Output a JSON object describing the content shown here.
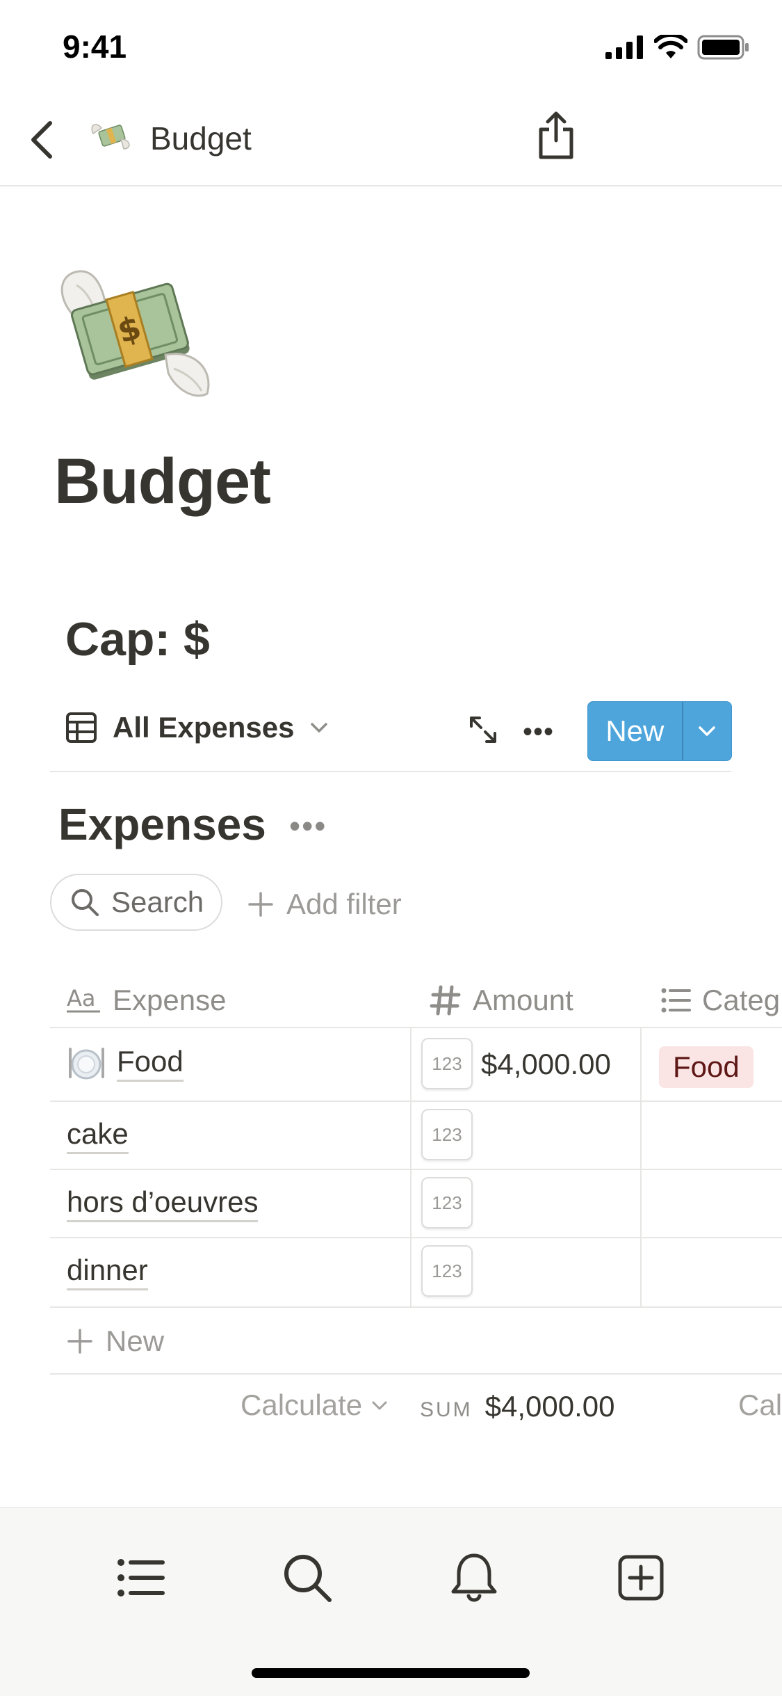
{
  "status_bar": {
    "time": "9:41"
  },
  "nav": {
    "title": "Budget",
    "emoji": "money-with-wings"
  },
  "page": {
    "title": "Budget",
    "icon": "money-with-wings",
    "cap_heading": "Cap: $"
  },
  "toolbar": {
    "view_label": "All Expenses",
    "new_label": "New"
  },
  "database": {
    "title": "Expenses",
    "search_label": "Search",
    "add_filter_label": "Add filter",
    "columns": [
      {
        "label": "Expense",
        "icon": "text-aa-icon"
      },
      {
        "label": "Amount",
        "icon": "hash-icon"
      },
      {
        "label": "Categ",
        "icon": "list-icon"
      }
    ],
    "rows": [
      {
        "name": "Food",
        "emoji": "plate-with-cutlery",
        "amount": "$4,000.00",
        "category": "Food",
        "badge": "123"
      },
      {
        "name": "cake",
        "amount": "",
        "category": "",
        "badge": "123"
      },
      {
        "name": "hors d’oeuvres",
        "amount": "",
        "category": "",
        "badge": "123"
      },
      {
        "name": "dinner",
        "amount": "",
        "category": "",
        "badge": "123"
      }
    ],
    "new_row_label": "New",
    "footer": {
      "calculate_label": "Calculate",
      "sum_key": "SUM",
      "sum_value": "$4,000.00",
      "calc_truncated": "Cal"
    }
  },
  "colors": {
    "accent": "#4ea5dc",
    "tag_bg": "#fbe4e4",
    "tag_text": "#5d1715",
    "text": "#37352f"
  }
}
